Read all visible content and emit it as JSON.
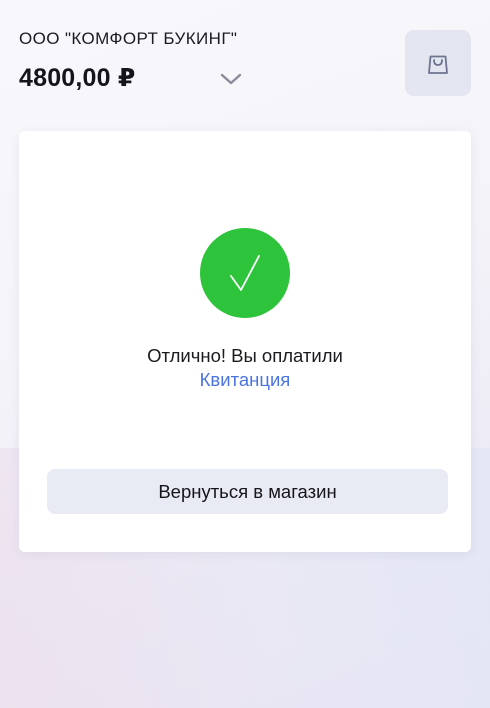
{
  "header": {
    "merchant_name": "ООО \"КОМФОРТ БУКИНГ\"",
    "amount": "4800,00 ₽",
    "expand_icon": "chevron-down-icon",
    "cart_icon": "shopping-bag-icon"
  },
  "result": {
    "status_icon": "checkmark-icon",
    "message": "Отлично! Вы оплатили",
    "receipt_link": "Квитанция",
    "back_button_label": "Вернуться в магазин"
  },
  "colors": {
    "success": "#2dc43b",
    "link": "#4a74e0",
    "button_bg": "#e8ebf4",
    "cart_button_bg": "#e3e6f0"
  }
}
